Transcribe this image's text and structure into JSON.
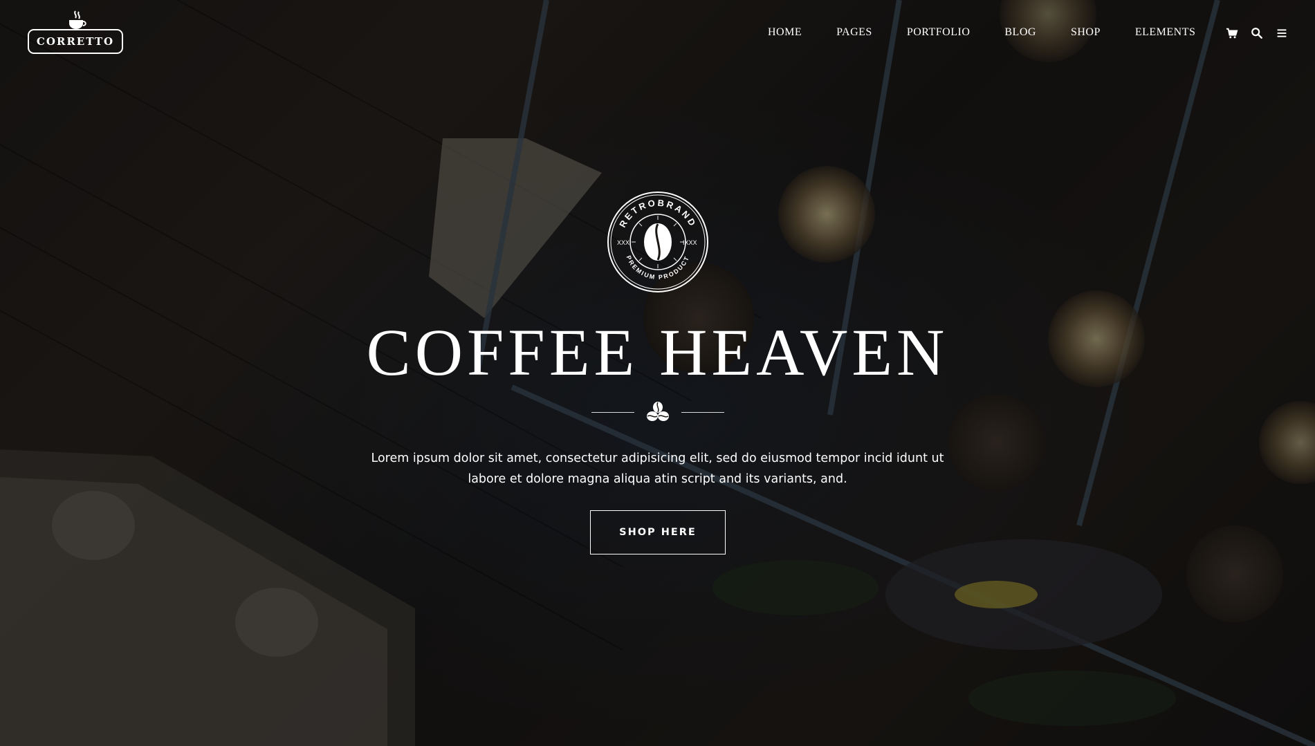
{
  "brand": {
    "name": "CORRETTO"
  },
  "nav": {
    "items": [
      {
        "label": "HOME"
      },
      {
        "label": "PAGES"
      },
      {
        "label": "PORTFOLIO"
      },
      {
        "label": "BLOG"
      },
      {
        "label": "SHOP"
      },
      {
        "label": "ELEMENTS"
      }
    ],
    "icons": [
      "cart-icon",
      "search-icon",
      "menu-icon"
    ]
  },
  "emblem": {
    "top_text": "RETROBRAND",
    "bottom_text": "PREMIUM PRODUCT",
    "left_text": "XXXI",
    "right_text": "IXXX"
  },
  "hero": {
    "title": "COFFEE HEAVEN",
    "lead_line1": "Lorem ipsum dolor sit amet, consectetur adipisicing elit, sed do eiusmod tempor incid idunt ut",
    "lead_line2": "labore et dolore magna aliqua atin script and its variants, and.",
    "cta_label": "SHOP HERE"
  },
  "colors": {
    "text": "#ffffff",
    "background": "#151312"
  }
}
